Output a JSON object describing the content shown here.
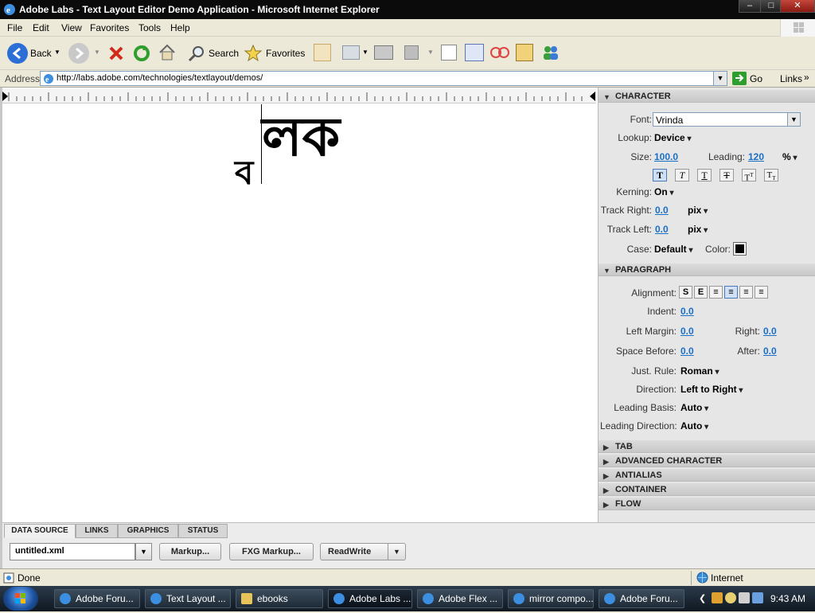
{
  "window": {
    "title": "Adobe Labs - Text Layout Editor Demo Application - Microsoft Internet Explorer",
    "min": "–",
    "max": "□",
    "close": "✕"
  },
  "menu": [
    "File",
    "Edit",
    "View",
    "Favorites",
    "Tools",
    "Help"
  ],
  "toolbar": {
    "back": "Back",
    "search": "Search",
    "favorites": "Favorites"
  },
  "address": {
    "label": "Address",
    "url": "http://labs.adobe.com/technologies/textlayout/demos/",
    "go": "Go",
    "links": "Links"
  },
  "editor": {
    "text_top": "লক",
    "text_left": "ব"
  },
  "character": {
    "header": "CHARACTER",
    "font_label": "Font:",
    "font_value": "Vrinda",
    "lookup_label": "Lookup:",
    "lookup_value": "Device",
    "size_label": "Size:",
    "size_value": "100.0",
    "leading_label": "Leading:",
    "leading_value": "120",
    "leading_unit": "%",
    "kerning_label": "Kerning:",
    "kerning_value": "On",
    "track_right_label": "Track Right:",
    "track_right_value": "0.0",
    "track_right_unit": "pix",
    "track_left_label": "Track Left:",
    "track_left_value": "0.0",
    "track_left_unit": "pix",
    "case_label": "Case:",
    "case_value": "Default",
    "color_label": "Color:",
    "color_value": "#000000"
  },
  "paragraph": {
    "header": "PARAGRAPH",
    "alignment_label": "Alignment:",
    "indent_label": "Indent:",
    "indent_value": "0.0",
    "left_margin_label": "Left Margin:",
    "left_margin_value": "0.0",
    "right_label": "Right:",
    "right_value": "0.0",
    "space_before_label": "Space Before:",
    "space_before_value": "0.0",
    "after_label": "After:",
    "after_value": "0.0",
    "just_rule_label": "Just. Rule:",
    "just_rule_value": "Roman",
    "direction_label": "Direction:",
    "direction_value": "Left to Right",
    "leading_basis_label": "Leading Basis:",
    "leading_basis_value": "Auto",
    "leading_direction_label": "Leading Direction:",
    "leading_direction_value": "Auto"
  },
  "collapsed_sections": [
    "TAB",
    "ADVANCED CHARACTER",
    "ANTIALIAS",
    "CONTAINER",
    "FLOW"
  ],
  "bottom_tabs": [
    "DATA SOURCE",
    "LINKS",
    "GRAPHICS",
    "STATUS"
  ],
  "data_source": {
    "file": "untitled.xml",
    "markup": "Markup...",
    "fxg": "FXG Markup...",
    "mode": "ReadWrite"
  },
  "status": {
    "text": "Done",
    "zone": "Internet"
  },
  "taskbar": {
    "tasks": [
      "Adobe Foru...",
      "Text Layout ...",
      "ebooks",
      "Adobe Labs ...",
      "Adobe Flex ...",
      "mirror compo...",
      "Adobe Foru..."
    ],
    "clock": "9:43 AM"
  }
}
